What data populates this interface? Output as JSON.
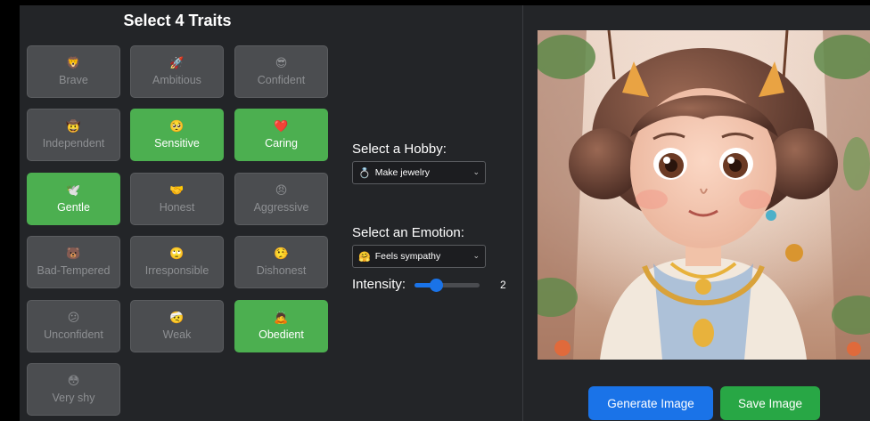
{
  "title": "Select 4 Traits",
  "traits": [
    {
      "label": "Brave",
      "emoji": "🦁",
      "selected": false
    },
    {
      "label": "Ambitious",
      "emoji": "🚀",
      "selected": false
    },
    {
      "label": "Confident",
      "emoji": "😎",
      "selected": false
    },
    {
      "label": "Independent",
      "emoji": "🤠",
      "selected": false
    },
    {
      "label": "Sensitive",
      "emoji": "🥺",
      "selected": true
    },
    {
      "label": "Caring",
      "emoji": "❤️",
      "selected": true
    },
    {
      "label": "Gentle",
      "emoji": "🕊️",
      "selected": true
    },
    {
      "label": "Honest",
      "emoji": "🤝",
      "selected": false
    },
    {
      "label": "Aggressive",
      "emoji": "😠",
      "selected": false
    },
    {
      "label": "Bad-Tempered",
      "emoji": "🐻",
      "selected": false
    },
    {
      "label": "Irresponsible",
      "emoji": "🙄",
      "selected": false
    },
    {
      "label": "Dishonest",
      "emoji": "🤥",
      "selected": false
    },
    {
      "label": "Unconfident",
      "emoji": "😕",
      "selected": false
    },
    {
      "label": "Weak",
      "emoji": "🤕",
      "selected": false
    },
    {
      "label": "Obedient",
      "emoji": "🙇",
      "selected": true
    },
    {
      "label": "Very shy",
      "emoji": "😳",
      "selected": false
    }
  ],
  "hobby": {
    "label": "Select a Hobby:",
    "icon": "💍",
    "value": "Make jewelry"
  },
  "emotion": {
    "label": "Select an Emotion:",
    "icon": "🤗",
    "value": "Feels sympathy"
  },
  "intensity": {
    "label": "Intensity:",
    "value": "2",
    "fraction": 0.33
  },
  "buttons": {
    "generate": "Generate Image",
    "save": "Save Image"
  },
  "colors": {
    "selected": "#4caf50",
    "unselected": "#4b4d50",
    "primary": "#1a73e8",
    "save": "#28a745"
  }
}
